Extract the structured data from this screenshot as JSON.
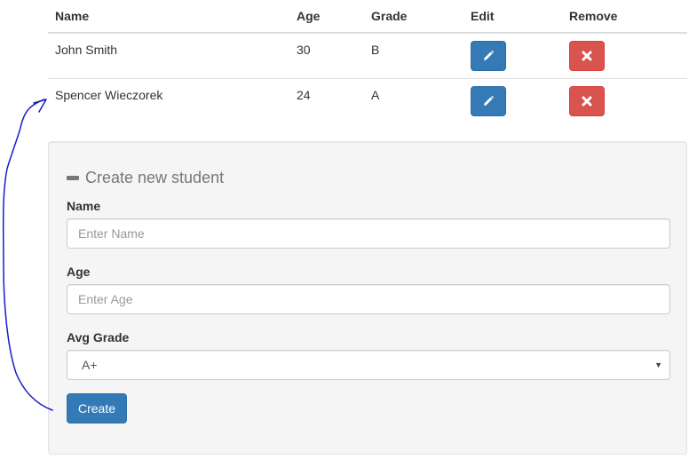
{
  "table": {
    "headers": {
      "name": "Name",
      "age": "Age",
      "grade": "Grade",
      "edit": "Edit",
      "remove": "Remove"
    },
    "rows": [
      {
        "name": "John Smith",
        "age": "30",
        "grade": "B"
      },
      {
        "name": "Spencer Wieczorek",
        "age": "24",
        "grade": "A"
      }
    ],
    "edit_icon": "pencil-icon",
    "remove_icon": "close-icon"
  },
  "form": {
    "title": "Create new student",
    "title_icon": "minus-icon",
    "name_label": "Name",
    "name_placeholder": "Enter Name",
    "age_label": "Age",
    "age_placeholder": "Enter Age",
    "grade_label": "Avg Grade",
    "grade_selected": "A+",
    "create_label": "Create"
  },
  "colors": {
    "primary": "#337ab7",
    "danger": "#d9534f",
    "annotation": "#1a1acc"
  }
}
